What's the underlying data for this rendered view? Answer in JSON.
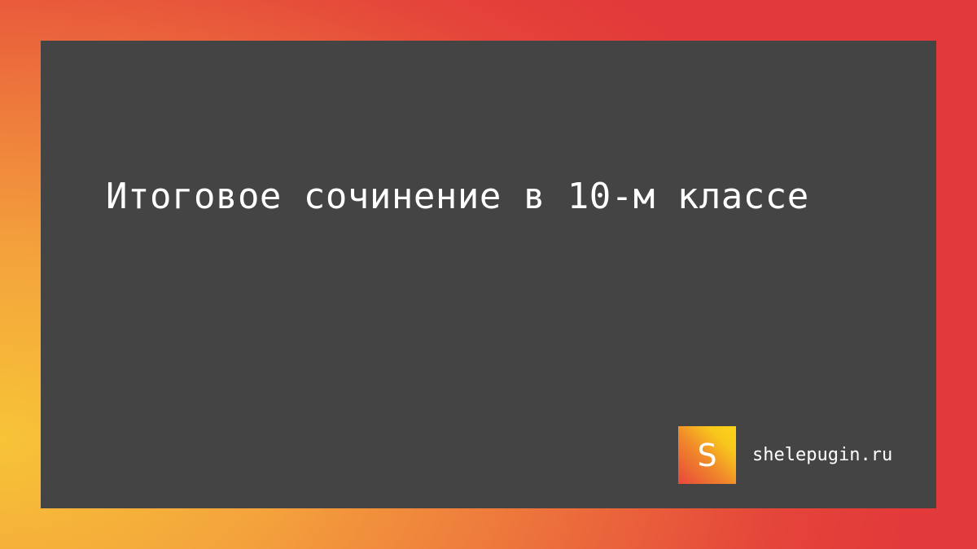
{
  "title": "Итоговое сочинение в 10-м классе",
  "brand": {
    "logo_letter": "S",
    "site": "shelepugin.ru"
  },
  "colors": {
    "panel": "#444444",
    "text": "#ffffff",
    "gradient_warm": "#f7c437",
    "gradient_hot": "#e2393a"
  }
}
